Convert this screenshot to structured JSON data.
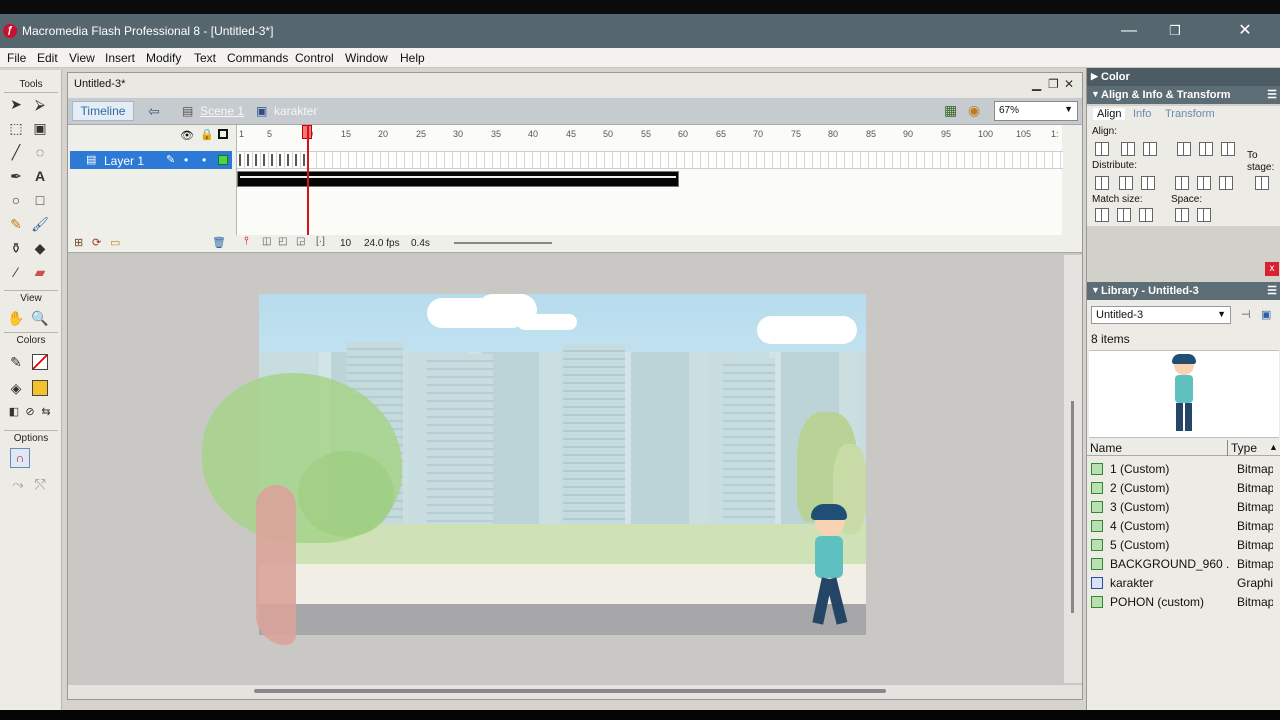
{
  "window": {
    "title": "Macromedia Flash Professional 8 - [Untitled-3*]",
    "minimize": "—",
    "restore": "❐",
    "close": "✕"
  },
  "menu": [
    "File",
    "Edit",
    "View",
    "Insert",
    "Modify",
    "Text",
    "Commands",
    "Control",
    "Window",
    "Help"
  ],
  "tools": {
    "header": "Tools",
    "view_header": "View",
    "colors_header": "Colors",
    "options_header": "Options",
    "stroke_color": "#000000",
    "fill_color": "#f5c12c"
  },
  "document": {
    "tab": "Untitled-3*",
    "timeline_button": "Timeline",
    "scene": "Scene 1",
    "symbol": "karakter",
    "zoom": "67%"
  },
  "timeline": {
    "layer": "Layer 1",
    "ticks": [
      "1",
      "5",
      "10",
      "15",
      "20",
      "25",
      "30",
      "35",
      "40",
      "45",
      "50",
      "55",
      "60",
      "65",
      "70",
      "75",
      "80",
      "85",
      "90",
      "95",
      "100",
      "105",
      "1:"
    ],
    "current_frame": "10",
    "fps": "24.0 fps",
    "time": "0.4s"
  },
  "panels": {
    "color": "Color",
    "align_info_transform": "Align & Info & Transform",
    "tabs": [
      "Align",
      "Info",
      "Transform"
    ],
    "align_label": "Align:",
    "distribute_label": "Distribute:",
    "match_size_label": "Match size:",
    "space_label": "Space:",
    "to_stage_label": "To stage:",
    "library_title": "Library - Untitled-3",
    "library_select": "Untitled-3",
    "library_count": "8 items",
    "col_name": "Name",
    "col_type": "Type",
    "close_x": "x"
  },
  "library_items": [
    {
      "name": "1 (Custom)",
      "type": "Bitmap"
    },
    {
      "name": "2 (Custom)",
      "type": "Bitmap"
    },
    {
      "name": "3 (Custom)",
      "type": "Bitmap"
    },
    {
      "name": "4 (Custom)",
      "type": "Bitmap"
    },
    {
      "name": "5 (Custom)",
      "type": "Bitmap"
    },
    {
      "name": "BACKGROUND_960 ...",
      "type": "Bitmap"
    },
    {
      "name": "karakter",
      "type": "Graphic"
    },
    {
      "name": "POHON (custom)",
      "type": "Bitmap"
    }
  ]
}
